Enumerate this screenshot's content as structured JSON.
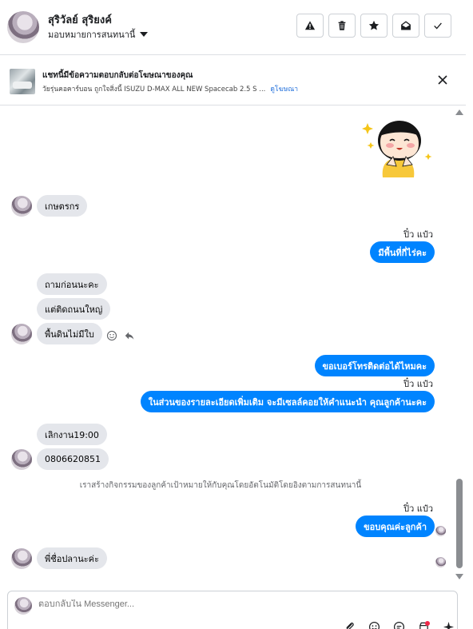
{
  "header": {
    "contact_name": "สุริวัลย์ สุริยงค์",
    "assign_label": "มอบหมายการสนทนานี้",
    "actions": [
      "spam-icon",
      "trash-icon",
      "star-icon",
      "unread-icon",
      "done-icon"
    ]
  },
  "ad_banner": {
    "title": "แชทนี้มีข้อความตอบกลับต่อโฆษณาของคุณ",
    "ad_text": "วัยรุ่นคอคาร์บอน ถูกใจสิ่งนี้ ISUZU D-MAX ALL NEW Spacecab 2.5 S ...",
    "view_ad_link": "ดูโฆษณา"
  },
  "messages": [
    {
      "direction": "in",
      "text": "เกษตรกร"
    },
    {
      "direction": "out",
      "sender": "ปิ๋ว แป๋ว",
      "text": "มีพื้นที่กี่ไร่คะ"
    },
    {
      "direction": "in",
      "text": "ถามก่อนนะคะ"
    },
    {
      "direction": "in",
      "text": "แต่ติดถนนใหญ่"
    },
    {
      "direction": "in",
      "text": "พื้นดินไม่มีใบ"
    },
    {
      "direction": "out",
      "text": "ขอเบอร์โทรติดต่อได้ไหมคะ"
    },
    {
      "direction": "out",
      "sender": "ปิ๋ว แป๋ว",
      "text": "ในส่วนของรายละเอียดเพิ่มเติม จะมีเซลล์คอยให้คำแนะนำ คุณลูกค้านะคะ"
    },
    {
      "direction": "in",
      "text": "เลิกงาน19:00"
    },
    {
      "direction": "in",
      "text": "0806620851"
    },
    {
      "direction": "out",
      "sender": "ปิ๋ว แป๋ว",
      "text": "ขอบคุณค่ะลูกค้า"
    },
    {
      "direction": "in",
      "text": "พี่ชื่อปลานะค่ะ"
    }
  ],
  "system_message": "เราสร้างกิจกรรมของลูกค้าเป้าหมายให้กับคุณโดยอัตโนมัติโดยอิงตามการสนทนานี้",
  "composer": {
    "placeholder": "ตอบกลับใน Messenger..."
  },
  "colors": {
    "outgoing_bubble": "#0084ff",
    "incoming_bubble": "#e4e6eb",
    "notification_dot": "#f02849"
  }
}
